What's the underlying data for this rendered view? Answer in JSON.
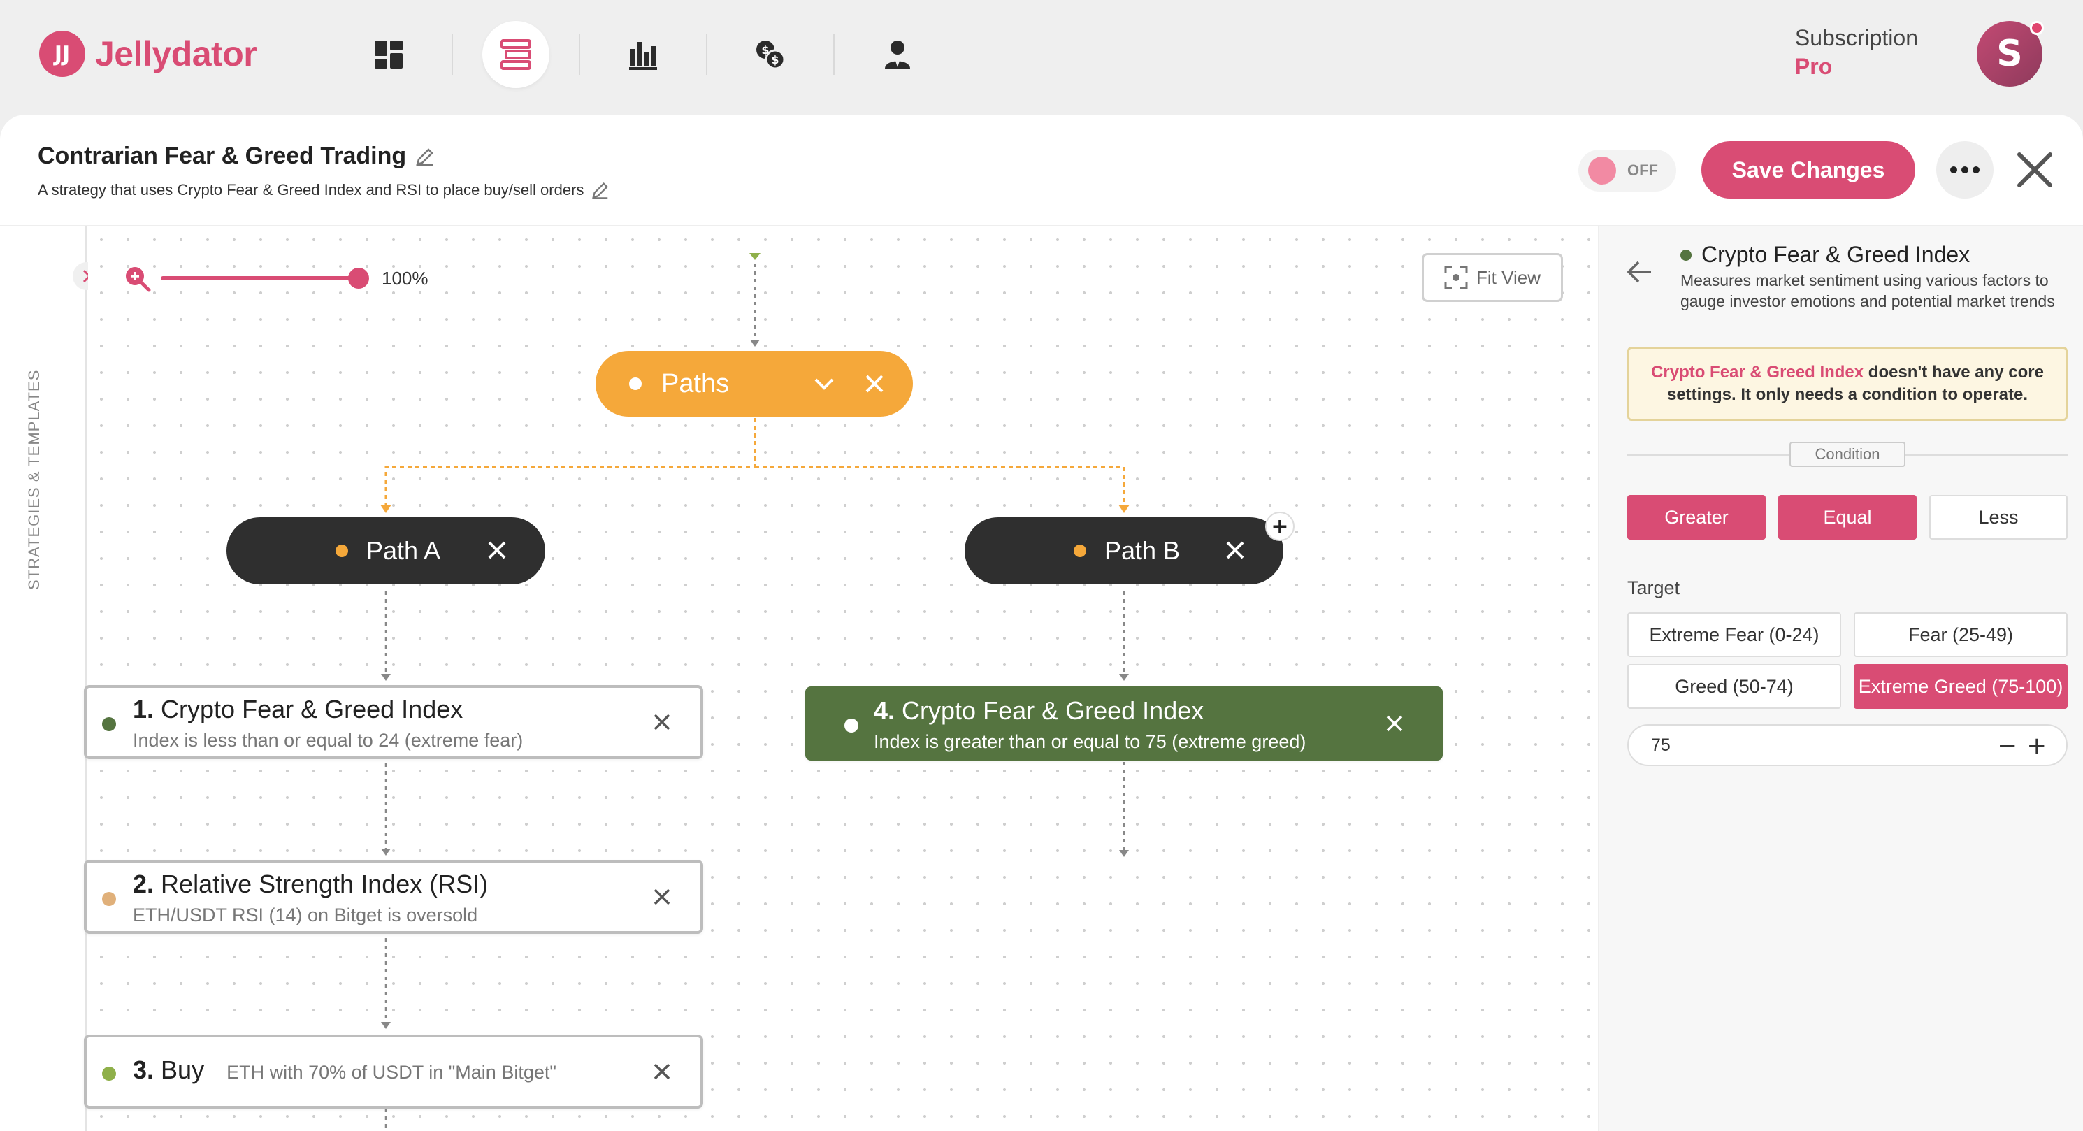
{
  "app": {
    "logo_mark": "JJ",
    "name": "Jellydator"
  },
  "nav": {
    "icons": [
      "dashboard-icon",
      "strategy-builder-icon",
      "chart-icon",
      "exchange-icon",
      "account-icon"
    ],
    "active_index": 1
  },
  "subscription": {
    "label": "Subscription",
    "plan": "Pro",
    "avatar_initial": "S"
  },
  "strategy": {
    "title": "Contrarian Fear & Greed Trading",
    "description": "A strategy that uses Crypto Fear & Greed Index and RSI to place buy/sell orders",
    "toggle_label": "OFF",
    "save_label": "Save Changes"
  },
  "sidebar": {
    "label": "STRATEGIES & TEMPLATES"
  },
  "canvas": {
    "zoom_label": "100%",
    "fit_view_label": "Fit View",
    "nodes": {
      "paths": "Paths",
      "path_a": "Path A",
      "path_b": "Path B",
      "step1": {
        "num": "1.",
        "title": "Crypto Fear & Greed Index",
        "subtitle": "Index is less than or equal to 24 (extreme fear)"
      },
      "step2": {
        "num": "2.",
        "title": "Relative Strength Index (RSI)",
        "subtitle": "ETH/USDT RSI (14) on Bitget is oversold"
      },
      "step3": {
        "num": "3.",
        "title": "Buy",
        "subtitle": "ETH with 70% of USDT in \"Main Bitget\""
      },
      "step4": {
        "num": "4.",
        "title": "Crypto Fear & Greed Index",
        "subtitle": "Index is greater than or equal to 75 (extreme greed)"
      }
    },
    "colors": {
      "paths": "#f5a83a",
      "path_node": "#2f2f2f",
      "selected_step": "#557440",
      "accent": "#d94c74"
    }
  },
  "panel": {
    "title": "Crypto Fear & Greed Index",
    "description": "Measures market sentiment using various factors to gauge investor emotions and potential market trends",
    "notice_highlight": "Crypto Fear & Greed Index",
    "notice_text": " doesn't have any core settings. It only needs a condition to operate.",
    "condition_label": "Condition",
    "conditions": [
      {
        "label": "Greater",
        "selected": true
      },
      {
        "label": "Equal",
        "selected": true
      },
      {
        "label": "Less",
        "selected": false
      }
    ],
    "target_label": "Target",
    "targets": [
      {
        "label": "Extreme Fear (0-24)",
        "selected": false
      },
      {
        "label": "Fear (25-49)",
        "selected": false
      },
      {
        "label": "Greed (50-74)",
        "selected": false
      },
      {
        "label": "Extreme Greed (75-100)",
        "selected": true
      }
    ],
    "value": "75"
  }
}
